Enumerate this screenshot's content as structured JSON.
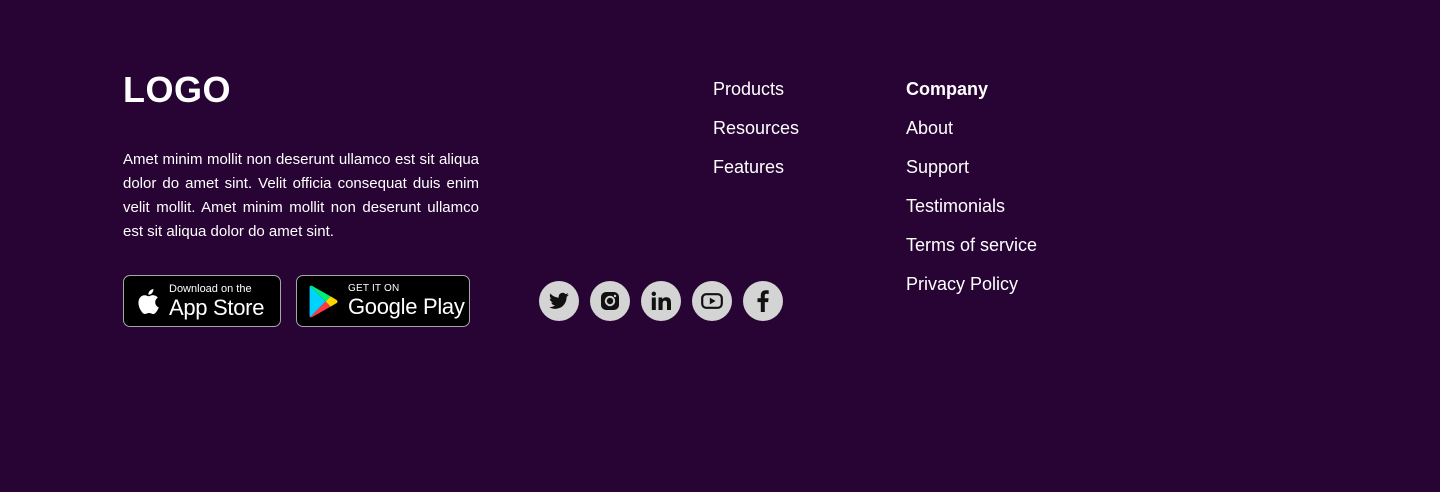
{
  "brand": {
    "logo_text": "LOGO",
    "description": "Amet minim mollit non deserunt ullamco est sit aliqua dolor do amet sint. Velit officia consequat duis enim velit mollit. Amet minim mollit non deserunt ullamco est sit aliqua dolor do amet sint."
  },
  "app_badges": {
    "apple": {
      "small_text": "Download on the",
      "large_text": "App Store",
      "icon": "apple-icon"
    },
    "google": {
      "small_text": "GET IT ON",
      "large_text": "Google Play",
      "icon": "google-play-icon"
    }
  },
  "social": [
    {
      "name": "twitter",
      "icon": "twitter-icon"
    },
    {
      "name": "instagram",
      "icon": "instagram-icon"
    },
    {
      "name": "linkedin",
      "icon": "linkedin-icon"
    },
    {
      "name": "youtube",
      "icon": "youtube-icon"
    },
    {
      "name": "facebook",
      "icon": "facebook-icon"
    }
  ],
  "nav_primary": {
    "items": [
      "Products",
      "Resources",
      "Features"
    ]
  },
  "nav_company": {
    "heading": "Company",
    "items": [
      "About",
      "Support",
      "Testimonials",
      "Terms of service",
      "Privacy Policy"
    ]
  },
  "colors": {
    "background": "#270433",
    "text": "#ffffff",
    "social_circle": "#d4d4d4",
    "badge_background": "#000000",
    "badge_border": "#a6a6a6"
  }
}
